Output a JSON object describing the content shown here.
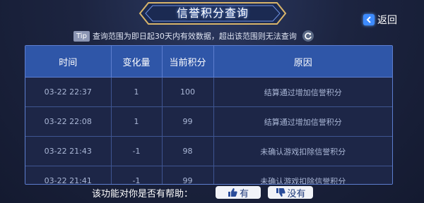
{
  "header": {
    "title": "信誉积分查询",
    "back_label": "返回"
  },
  "tip": {
    "badge": "Tip",
    "text": "查询范围为即日起30天内有效数据，超出该范围则无法查询"
  },
  "table": {
    "columns": [
      "时间",
      "变化量",
      "当前积分",
      "原因"
    ],
    "rows": [
      {
        "time": "03-22  22:37",
        "change": "1",
        "score": "100",
        "reason": "结算通过增加信誉积分"
      },
      {
        "time": "03-22  22:08",
        "change": "1",
        "score": "99",
        "reason": "结算通过增加信誉积分"
      },
      {
        "time": "03-22  21:43",
        "change": "-1",
        "score": "98",
        "reason": "未确认游戏扣除信誉积分"
      },
      {
        "time": "03-22  21:41",
        "change": "-1",
        "score": "99",
        "reason": "未确认游戏扣除信誉积分"
      }
    ]
  },
  "feedback": {
    "question": "该功能对你是否有帮助：",
    "yes_label": "有",
    "no_label": "没有"
  },
  "colors": {
    "background": "#1c2440",
    "header_row": "#2f56a8",
    "accent": "#3d8bff",
    "gold": "#d9b56a"
  }
}
